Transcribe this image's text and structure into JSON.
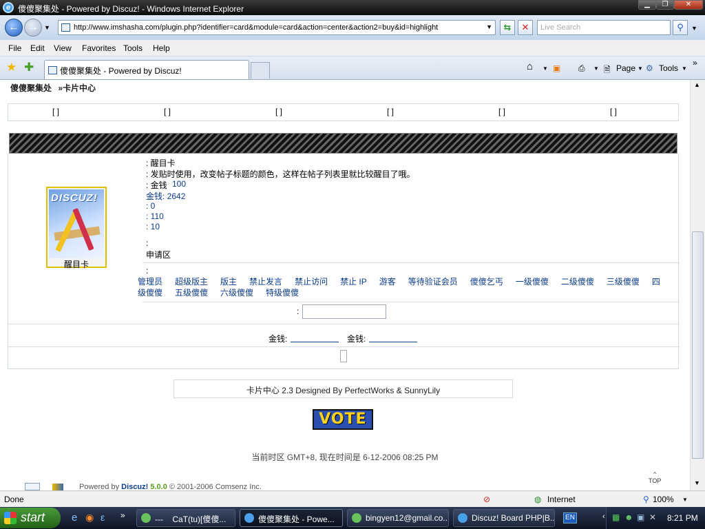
{
  "window": {
    "title": "傻傻聚集处 - Powered by Discuz! - Windows Internet Explorer"
  },
  "address": {
    "url": "http://www.imshasha.com/plugin.php?identifier=card&module=card&action=center&action2=buy&id=highlight",
    "search_placeholder": "Live Search"
  },
  "menu": [
    "File",
    "Edit",
    "View",
    "Favorites",
    "Tools",
    "Help"
  ],
  "tab": {
    "title": "傻傻聚集处 - Powered by Discuz!"
  },
  "toolbar": {
    "page": "Page",
    "tools": "Tools"
  },
  "breadcrumb": {
    "site": "傻傻聚集处",
    "sep_page": "»卡片中心"
  },
  "tabrow": [
    "[ ]",
    "[ ]",
    "[ ]",
    "[ ]",
    "[ ]",
    "[ ]"
  ],
  "card": {
    "logo": "DISCUZ!",
    "caption": "醒目卡",
    "name": ": 醒目卡",
    "desc": ": 发贴时使用，改变帖子标题的颜色，这样在帖子列表里就比较醒目了哦。",
    "price_label": ": 金钱",
    "price": "100",
    "money": "金钱: 2642",
    "v1": ": 0",
    "v2": ": 110",
    "v3": ": 10",
    "colon": ":",
    "area": "申请区",
    "groups_colon": ":",
    "groups": [
      "管理员",
      "超级版主",
      "版主",
      "禁止发言",
      "禁止访问",
      "禁止 IP",
      "游客",
      "等待验证会员",
      "傻傻乞丐",
      "一级傻傻",
      "二级傻傻",
      "三级傻傻",
      "四级傻傻",
      "五级傻傻",
      "六级傻傻",
      "特级傻傻"
    ],
    "input_colon": ":",
    "money_label_1": "金钱:",
    "money_label_2": "金钱:"
  },
  "footer": {
    "designed": "卡片中心 2.3 Designed By PerfectWorks & SunnyLily",
    "vote": "VOTE",
    "time": "当前时区 GMT+8, 现在时间是 6-12-2006 08:25 PM",
    "powered_prefix": "Powered by",
    "powered_brand": "Discuz!",
    "powered_version": "5.0.0",
    "copyright": "© 2001-2006 Comsenz Inc.",
    "top": "TOP"
  },
  "status": {
    "text": "Done",
    "zone": "Internet",
    "zoom": "100%"
  },
  "taskbar": {
    "start": "start",
    "tasks": [
      "CaT(tu)[傻傻...",
      "傻傻聚集处 - Powe...",
      "bingyen12@gmail.co...",
      "Discuz! Board PHP|B..."
    ],
    "dashes": "---",
    "lang": "EN",
    "clock": "8:21 PM"
  }
}
